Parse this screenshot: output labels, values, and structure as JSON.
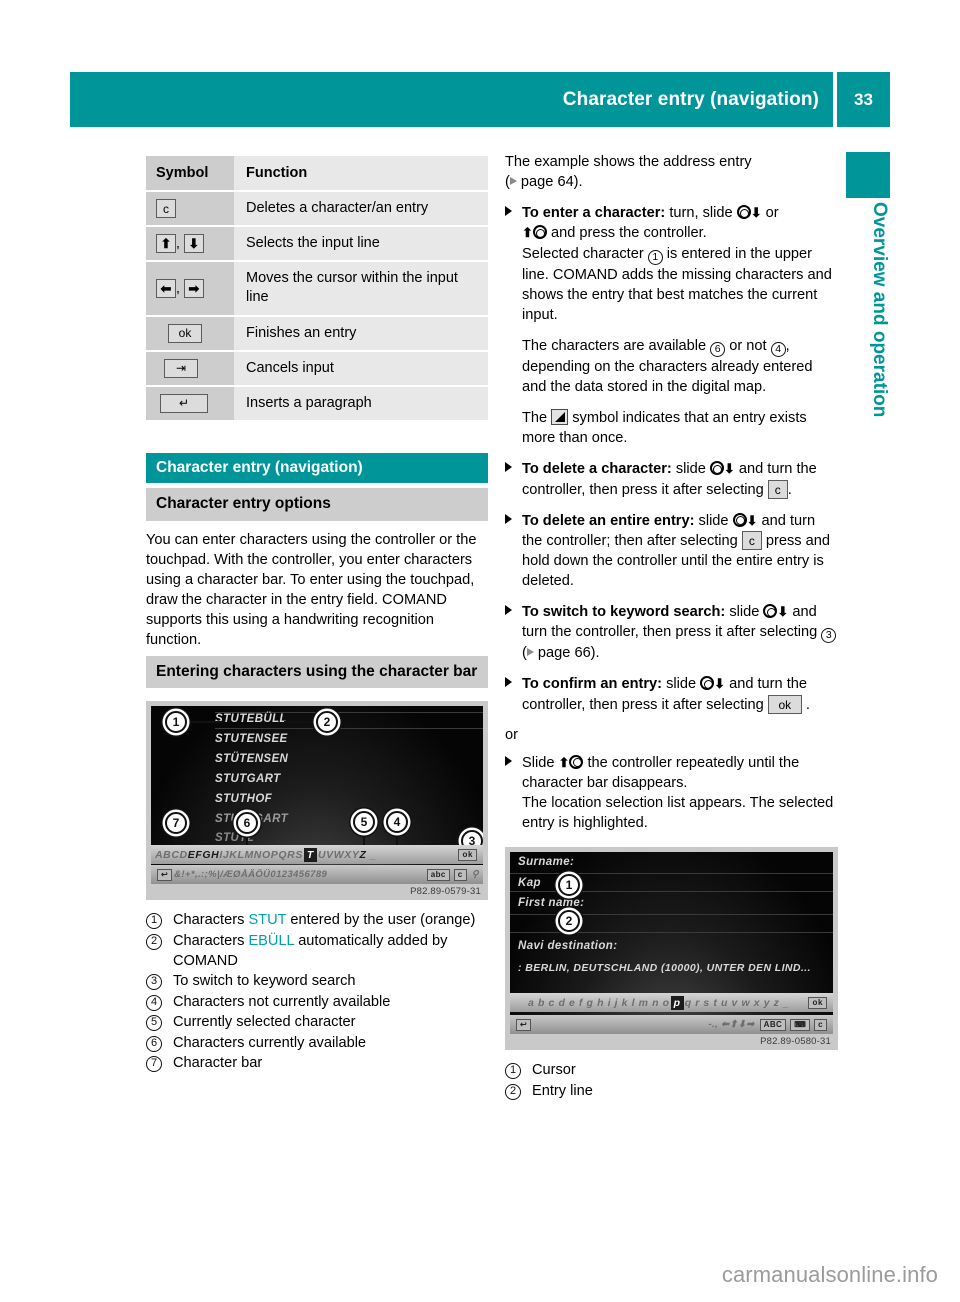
{
  "header": {
    "title": "Character entry (navigation)",
    "page_number": "33"
  },
  "side_tab": {
    "label": "Overview and operation"
  },
  "table": {
    "headers": [
      "Symbol",
      "Function"
    ],
    "rows": [
      {
        "symbol_keys": [
          "c"
        ],
        "function": "Deletes a character/an entry"
      },
      {
        "symbol_keys": [
          "↑",
          "↓"
        ],
        "function": "Selects the input line"
      },
      {
        "symbol_keys": [
          "←",
          "→"
        ],
        "function": "Moves the cursor within the input line"
      },
      {
        "symbol_keys": [
          "ok"
        ],
        "function": "Finishes an entry"
      },
      {
        "symbol_keys": [
          "↰"
        ],
        "function": "Cancels input"
      },
      {
        "symbol_keys": [
          "↵"
        ],
        "function": "Inserts a paragraph"
      }
    ]
  },
  "left": {
    "section_heading": "Character entry (navigation)",
    "sub_heading": "Character entry options",
    "body": "You can enter characters using the controller or the touchpad. With the controller, you enter characters using a character bar. To enter using the touchpad, draw the character in the entry field. COMAND supports this using a handwriting recognition function.",
    "sub_heading_2": "Entering characters using the character bar",
    "screenshot": {
      "caption": "P82.89-0579-31",
      "list_entries": [
        "STUTEBÜLL",
        "STUTENSEE",
        "STÜTENSEN",
        "STUTGART",
        "STUTHOF",
        "STUTTGART",
        "STUTZ"
      ],
      "char_bar_row1": "ABCDEFGHIJKLMNOPQRSTUVWXYZ",
      "char_bar_available": "EFGH",
      "char_bar_selected": "T",
      "char_bar_ok": "ok",
      "char_bar_row2": "&!+*,.:;\\%|/Æ0ÅÃÕÜ0123456789",
      "char_bar_delete": "c",
      "callouts": [
        "1",
        "2",
        "3",
        "4",
        "5",
        "6",
        "7"
      ]
    },
    "legend": [
      {
        "num": "1",
        "pre": "Characters ",
        "hl": "STUT",
        "post": " entered by the user (orange)"
      },
      {
        "num": "2",
        "pre": "Characters ",
        "hl": "EBÜLL",
        "post": " automatically added by COMAND"
      },
      {
        "num": "3",
        "pre": "To switch to keyword search",
        "hl": "",
        "post": ""
      },
      {
        "num": "4",
        "pre": "Characters not currently available",
        "hl": "",
        "post": ""
      },
      {
        "num": "5",
        "pre": "Currently selected character",
        "hl": "",
        "post": ""
      },
      {
        "num": "6",
        "pre": "Characters currently available",
        "hl": "",
        "post": ""
      },
      {
        "num": "7",
        "pre": "Character bar",
        "hl": "",
        "post": ""
      }
    ]
  },
  "right": {
    "intro_line1": "The example shows the address entry",
    "intro_line2_pre": "(",
    "intro_line2_post": " page 64).",
    "items": [
      {
        "bold": "To enter a character:",
        "rest_a": " turn, slide ",
        "rest_b": " or",
        "line2_a": " and press the controller.",
        "para2_a": "Selected character ",
        "para2_num": "1",
        "para2_b": " is entered in the upper line. COMAND adds the missing characters and shows the entry that best matches the current input."
      }
    ],
    "para_available_a": "The characters are available ",
    "para_available_n1": "6",
    "para_available_b": " or not ",
    "para_available_n2": "4",
    "para_available_c": ", depending on the characters already entered and the data stored in the digital map.",
    "para_symbol_a": "The ",
    "para_symbol_b": " symbol indicates that an entry exists more than once.",
    "delete_char": {
      "bold": "To delete a character:",
      "a": " slide ",
      "b": " and turn the controller, then press it after selecting ",
      "key": "c",
      "c": "."
    },
    "delete_entry": {
      "bold": "To delete an entire entry:",
      "a": " slide ",
      "b": " and turn the controller; then after selecting ",
      "key": "c",
      "c": " press and hold down the controller until the entire entry is deleted."
    },
    "keyword": {
      "bold": "To switch to keyword search:",
      "a": " slide ",
      "b": " and turn the controller, then press it after selecting ",
      "num": "3",
      "c": " (",
      "d": " page 66)."
    },
    "confirm": {
      "bold": "To confirm an entry:",
      "a": " slide ",
      "b": " and turn the controller, then press it after selecting ",
      "key": "ok",
      "c": " ."
    },
    "or_label": "or",
    "slide_item": {
      "a": "Slide ",
      "b": " the controller repeatedly until the character bar disappears.",
      "c": "The location selection list appears. The selected entry is highlighted."
    },
    "screenshot": {
      "caption": "P82.89-0580-31",
      "field_surname_label": "Surname:",
      "field_surname_value": "Kap",
      "field_firstname_label": "First name:",
      "field_firstname_value": "",
      "field_navi_label": "Navi destination:",
      "field_navi_value": ": BERLIN, DEUTSCHLAND (10000), UNTER DEN LIND...",
      "char_bar_row1": "abcdefghijklmnopqrstuvwxyz_",
      "char_bar_selected": "p",
      "char_bar_ok": "ok",
      "char_bar_row2": "-.,",
      "char_bar_abc": "ABC",
      "char_bar_delete": "c",
      "callouts": [
        "1",
        "2"
      ]
    },
    "legend": [
      {
        "num": "1",
        "label": "Cursor"
      },
      {
        "num": "2",
        "label": "Entry line"
      }
    ]
  },
  "watermark": "carmanualsonline.info",
  "colors": {
    "teal": "#009699",
    "highlight": "#00a0a8",
    "header_gray": "#cdcdcd",
    "row_gray": "#e8e8e8"
  }
}
